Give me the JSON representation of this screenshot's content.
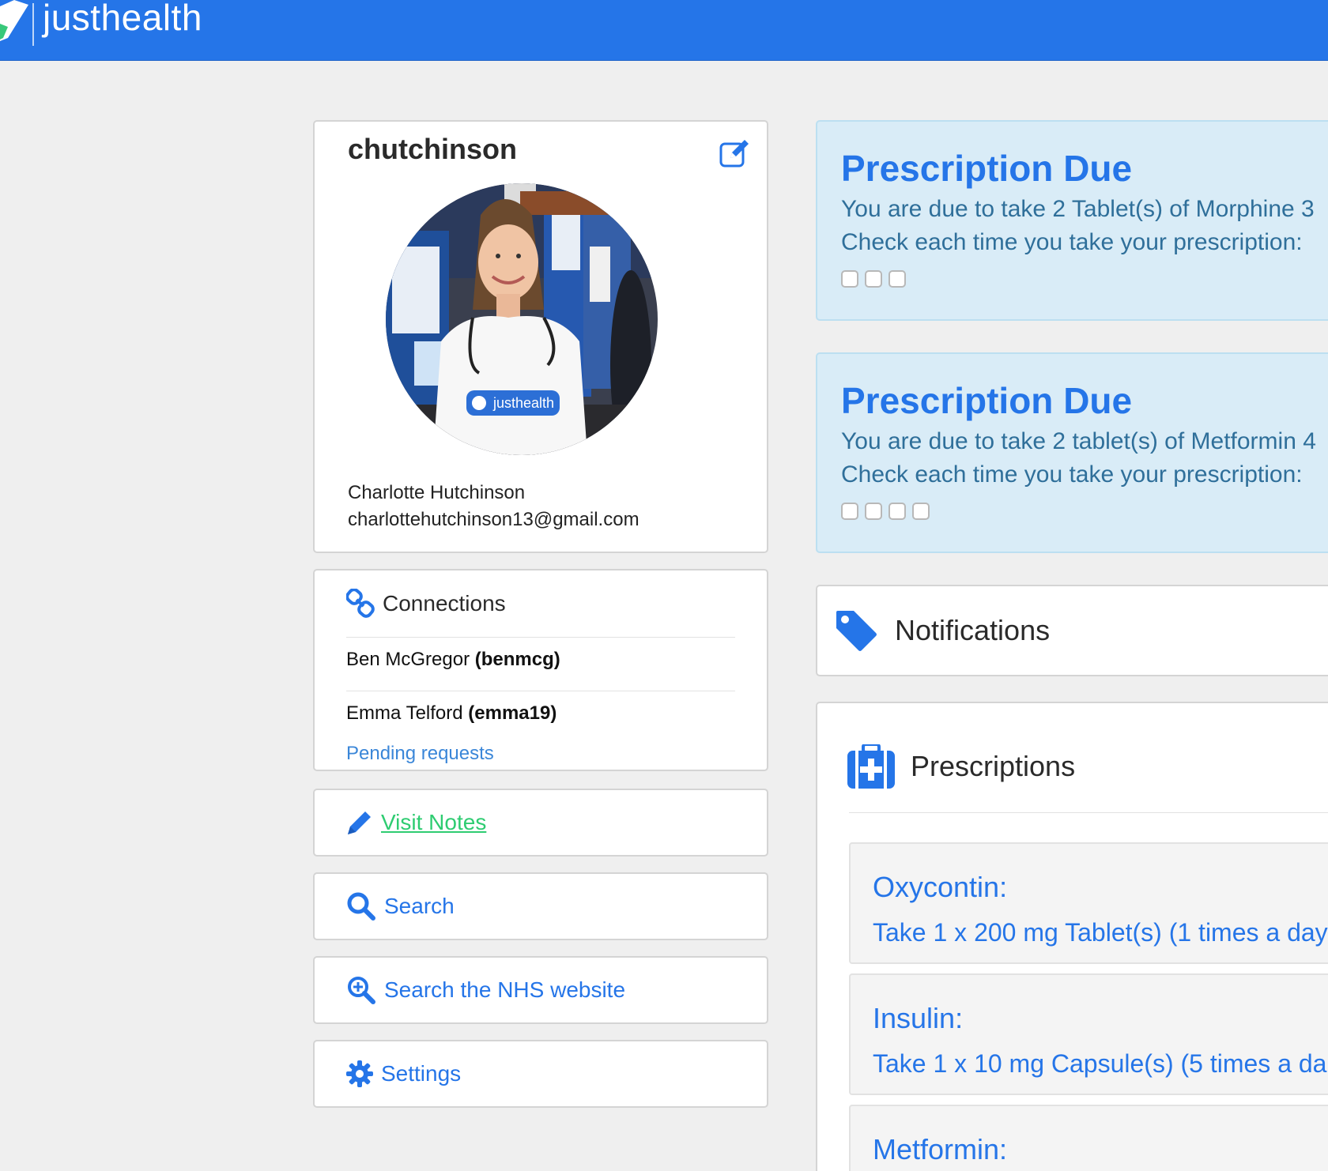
{
  "header": {
    "app_name": "justhealth"
  },
  "profile": {
    "username": "chutchinson",
    "full_name": "Charlotte Hutchinson",
    "email": "charlottehutchinson13@gmail.com",
    "shirt_text": "justhealth"
  },
  "connections": {
    "title": "Connections",
    "items": [
      {
        "name": "Ben McGregor",
        "handle": "(benmcg)"
      },
      {
        "name": "Emma Telford",
        "handle": "(emma19)"
      }
    ],
    "pending_label": "Pending requests"
  },
  "links": {
    "visit_notes": "Visit Notes",
    "search": "Search",
    "search_nhs": "Search the NHS website",
    "settings": "Settings"
  },
  "alerts": [
    {
      "title": "Prescription Due",
      "message": "You are due to take 2 Tablet(s) of Morphine 3",
      "check_prompt": "Check each time you take your prescription:",
      "checkbox_count": 3
    },
    {
      "title": "Prescription Due",
      "message": "You are due to take 2 tablet(s) of Metformin 4",
      "check_prompt": "Check each time you take your prescription:",
      "checkbox_count": 4
    }
  ],
  "notifications": {
    "title": "Notifications"
  },
  "prescriptions": {
    "title": "Prescriptions",
    "items": [
      {
        "name": "Oxycontin:",
        "detail": "Take 1 x 200 mg Tablet(s) (1 times a day"
      },
      {
        "name": "Insulin:",
        "detail": "Take 1 x 10 mg Capsule(s) (5 times a da"
      },
      {
        "name": "Metformin:",
        "detail": ""
      }
    ]
  },
  "colors": {
    "primary": "#2575e8",
    "alert_bg": "#d9ecf7",
    "alert_text": "#2f6f9a",
    "visit_notes": "#2ecc71",
    "page_bg": "#efefef"
  }
}
